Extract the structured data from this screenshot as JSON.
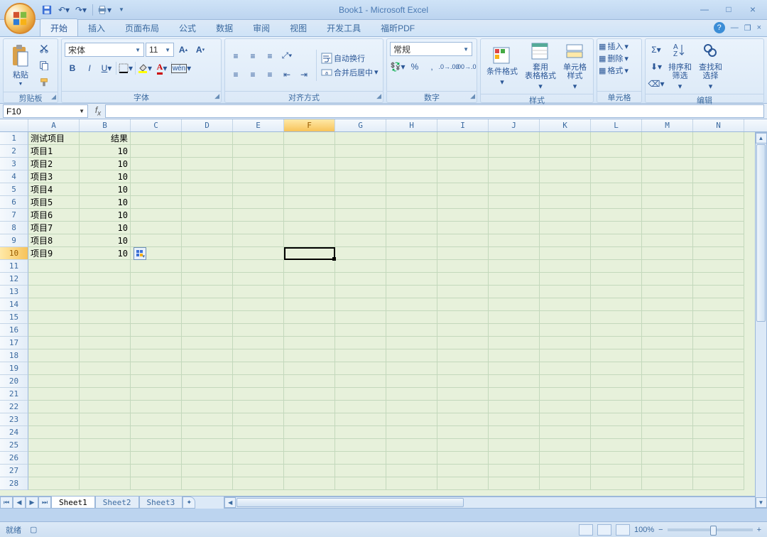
{
  "title": "Book1 - Microsoft Excel",
  "qat": {
    "items": [
      "save",
      "undo",
      "redo",
      "print"
    ]
  },
  "tabs": [
    "开始",
    "插入",
    "页面布局",
    "公式",
    "数据",
    "审阅",
    "视图",
    "开发工具",
    "福昕PDF"
  ],
  "active_tab": 0,
  "ribbon": {
    "clipboard": {
      "paste": "粘贴",
      "label": "剪贴板"
    },
    "font": {
      "name": "宋体",
      "size": "11",
      "label": "字体"
    },
    "align": {
      "wrap": "自动换行",
      "merge": "合并后居中",
      "label": "对齐方式"
    },
    "number": {
      "format": "常规",
      "label": "数字"
    },
    "styles": {
      "cond": "条件格式",
      "table": "套用\n表格格式",
      "cell": "单元格\n样式",
      "label": "样式"
    },
    "cells": {
      "insert": "插入",
      "delete": "删除",
      "format": "格式",
      "label": "单元格"
    },
    "editing": {
      "sort": "排序和\n筛选",
      "find": "查找和\n选择",
      "label": "编辑"
    }
  },
  "namebox": "F10",
  "columns": [
    "A",
    "B",
    "C",
    "D",
    "E",
    "F",
    "G",
    "H",
    "I",
    "J",
    "K",
    "L",
    "M",
    "N"
  ],
  "sel_col": 5,
  "sel_row": 10,
  "rows": 28,
  "cells": {
    "A1": "测试项目",
    "B1": "结果",
    "A2": "项目1",
    "B2": "10",
    "A3": "项目2",
    "B3": "10",
    "A4": "项目3",
    "B4": "10",
    "A5": "项目4",
    "B5": "10",
    "A6": "项目5",
    "B6": "10",
    "A7": "项目6",
    "B7": "10",
    "A8": "项目7",
    "B8": "10",
    "A9": "项目8",
    "B9": "10",
    "A10": "项目9",
    "B10": "10"
  },
  "numeric_cols": [
    "B"
  ],
  "sheets": [
    "Sheet1",
    "Sheet2",
    "Sheet3"
  ],
  "active_sheet": 0,
  "status": {
    "ready": "就绪",
    "zoom": "100%"
  }
}
